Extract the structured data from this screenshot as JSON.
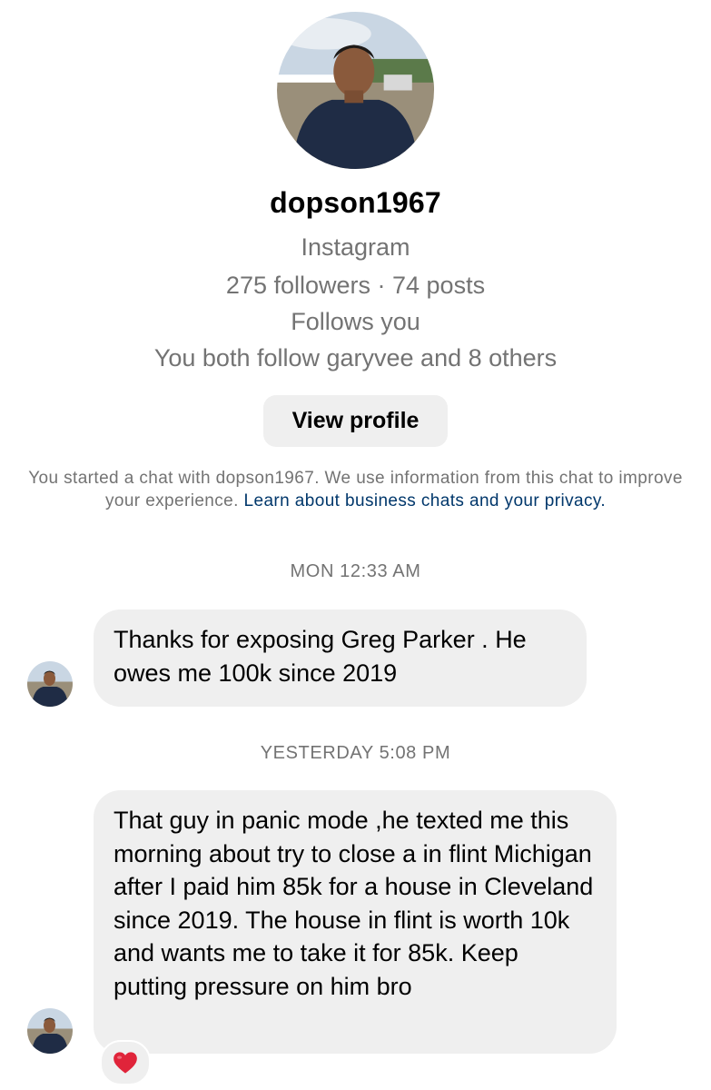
{
  "profile": {
    "username": "dopson1967",
    "platform": "Instagram",
    "stats": "275 followers · 74 posts",
    "follows_you": "Follows you",
    "mutual": "You both follow garyvee and 8 others",
    "view_profile_label": "View profile"
  },
  "notice": {
    "text": "You started a chat with dopson1967. We use information from this chat to improve your experience.",
    "link": "Learn about business chats and your privacy."
  },
  "messages": [
    {
      "timestamp": "MON 12:33 AM",
      "text": "Thanks for exposing Greg Parker . He owes me 100k since 2019"
    },
    {
      "timestamp": "YESTERDAY 5:08 PM",
      "text": "That guy in panic mode ,he texted me this morning about try to close a in flint Michigan after I paid him 85k for a house in Cleveland since 2019. The house in flint is worth 10k and wants me to take it for 85k. Keep putting pressure on him bro",
      "reaction": "heart-icon"
    }
  ],
  "colors": {
    "bubble": "#efefef",
    "secondary_text": "#737373",
    "link": "#00376b",
    "reaction_heart": "#e0243a"
  }
}
